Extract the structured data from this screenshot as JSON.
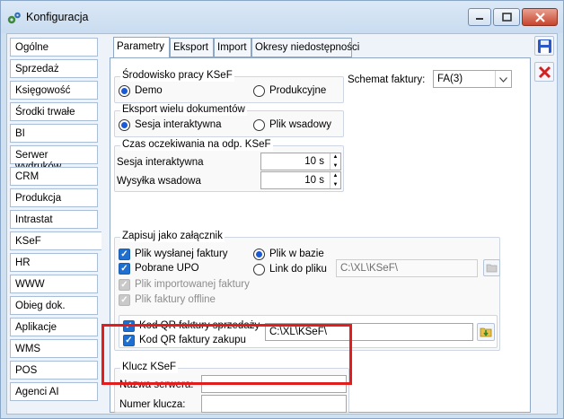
{
  "window": {
    "title": "Konfiguracja"
  },
  "sidebar": {
    "items": [
      {
        "label": "Ogólne"
      },
      {
        "label": "Sprzedaż"
      },
      {
        "label": "Księgowość"
      },
      {
        "label": "Środki trwałe"
      },
      {
        "label": "BI"
      },
      {
        "label": "Serwer wydruków"
      },
      {
        "label": "CRM"
      },
      {
        "label": "Produkcja"
      },
      {
        "label": "Intrastat"
      },
      {
        "label": "KSeF"
      },
      {
        "label": "HR"
      },
      {
        "label": "WWW"
      },
      {
        "label": "Obieg dok."
      },
      {
        "label": "Aplikacje"
      },
      {
        "label": "WMS"
      },
      {
        "label": "POS"
      },
      {
        "label": "Agenci AI"
      }
    ],
    "active": "KSeF"
  },
  "tabs": [
    {
      "label": "Parametry"
    },
    {
      "label": "Eksport"
    },
    {
      "label": "Import"
    },
    {
      "label": "Okresy niedostępności"
    }
  ],
  "environment": {
    "title": "Środowisko pracy KSeF",
    "demo": "Demo",
    "production": "Produkcyjne",
    "selected": "Demo"
  },
  "schema": {
    "label": "Schemat faktury:",
    "value": "FA(3)"
  },
  "export_mode": {
    "title": "Eksport wielu dokumentów",
    "interactive": "Sesja interaktywna",
    "batch": "Plik wsadowy",
    "selected": "Sesja interaktywna"
  },
  "timeouts": {
    "title": "Czas oczekiwania na odp. KSeF",
    "interactive_label": "Sesja interaktywna",
    "interactive_value": "10 s",
    "batch_label": "Wysyłka wsadowa",
    "batch_value": "10 s"
  },
  "attachments": {
    "title": "Zapisuj jako załącznik",
    "sent_invoice": "Plik wysłanej faktury",
    "upo": "Pobrane UPO",
    "imported_invoice": "Plik importowanej faktury",
    "offline_invoice": "Plik faktury offline",
    "in_db": "Plik w bazie",
    "file_link": "Link do pliku",
    "path": "C:\\XL\\KSeF\\",
    "qr_sales": "Kod QR faktury sprzedaży",
    "qr_purchase": "Kod QR faktury zakupu",
    "qr_path": "C:\\XL\\KSeF\\"
  },
  "key": {
    "title": "Klucz KSeF",
    "server_label": "Nazwa serwera:",
    "server_value": "",
    "key_label": "Numer klucza:",
    "key_value": ""
  },
  "colors": {
    "highlight": "#e21d1d",
    "accent": "#1f6fd0"
  }
}
